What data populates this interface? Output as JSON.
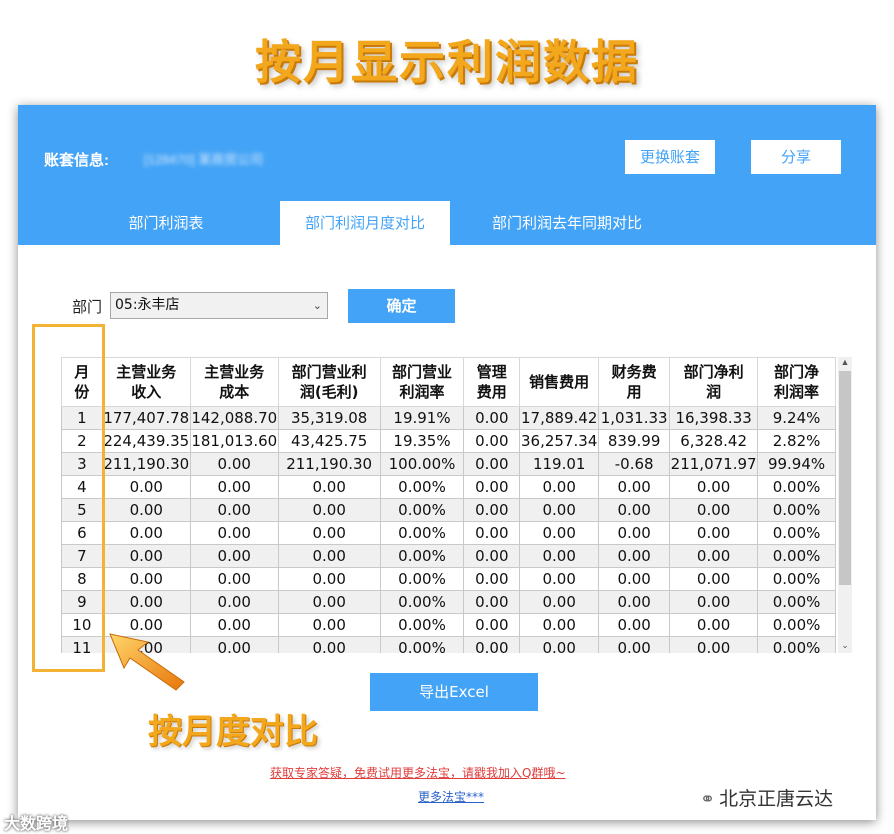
{
  "hero_title": "按月显示利润数据",
  "account": {
    "label": "账套信息:",
    "value": "[128470] 某商贸公司"
  },
  "buttons": {
    "switch_account": "更换账套",
    "share": "分享",
    "confirm": "确定",
    "export": "导出Excel"
  },
  "tabs": [
    {
      "label": "部门利润表",
      "active": false
    },
    {
      "label": "部门利润月度对比",
      "active": true
    },
    {
      "label": "部门利润去年同期对比",
      "active": false
    }
  ],
  "filter": {
    "label": "部门",
    "selected": "05:永丰店"
  },
  "table": {
    "columns": [
      "月份",
      "主营业务收入",
      "主营业务成本",
      "部门营业利润(毛利)",
      "部门营业利润率",
      "管理费用",
      "销售费用",
      "财务费用",
      "部门净利润",
      "部门净利润率"
    ],
    "header_lines": [
      [
        "月",
        "份"
      ],
      [
        "主营业务",
        "收入"
      ],
      [
        "主营业务",
        "成本"
      ],
      [
        "部门营业利",
        "润(毛利)"
      ],
      [
        "部门营业",
        "利润率"
      ],
      [
        "管理",
        "费用"
      ],
      [
        "销售费用",
        ""
      ],
      [
        "财务费",
        "用"
      ],
      [
        "部门净利",
        "润"
      ],
      [
        "部门净",
        "利润率"
      ]
    ],
    "rows": [
      [
        "1",
        "177,407.78",
        "142,088.70",
        "35,319.08",
        "19.91%",
        "0.00",
        "17,889.42",
        "1,031.33",
        "16,398.33",
        "9.24%"
      ],
      [
        "2",
        "224,439.35",
        "181,013.60",
        "43,425.75",
        "19.35%",
        "0.00",
        "36,257.34",
        "839.99",
        "6,328.42",
        "2.82%"
      ],
      [
        "3",
        "211,190.30",
        "0.00",
        "211,190.30",
        "100.00%",
        "0.00",
        "119.01",
        "-0.68",
        "211,071.97",
        "99.94%"
      ],
      [
        "4",
        "0.00",
        "0.00",
        "0.00",
        "0.00%",
        "0.00",
        "0.00",
        "0.00",
        "0.00",
        "0.00%"
      ],
      [
        "5",
        "0.00",
        "0.00",
        "0.00",
        "0.00%",
        "0.00",
        "0.00",
        "0.00",
        "0.00",
        "0.00%"
      ],
      [
        "6",
        "0.00",
        "0.00",
        "0.00",
        "0.00%",
        "0.00",
        "0.00",
        "0.00",
        "0.00",
        "0.00%"
      ],
      [
        "7",
        "0.00",
        "0.00",
        "0.00",
        "0.00%",
        "0.00",
        "0.00",
        "0.00",
        "0.00",
        "0.00%"
      ],
      [
        "8",
        "0.00",
        "0.00",
        "0.00",
        "0.00%",
        "0.00",
        "0.00",
        "0.00",
        "0.00",
        "0.00%"
      ],
      [
        "9",
        "0.00",
        "0.00",
        "0.00",
        "0.00%",
        "0.00",
        "0.00",
        "0.00",
        "0.00",
        "0.00%"
      ],
      [
        "10",
        "0.00",
        "0.00",
        "0.00",
        "0.00%",
        "0.00",
        "0.00",
        "0.00",
        "0.00",
        "0.00%"
      ],
      [
        "11",
        "0.00",
        "0.00",
        "0.00",
        "0.00%",
        "0.00",
        "0.00",
        "0.00",
        "0.00",
        "0.00%"
      ]
    ]
  },
  "annotation": {
    "caption": "按月度对比"
  },
  "links": {
    "expert": "获取专家答疑，免费试用更多法宝，请戳我加入Q群哦~",
    "more": "更多法宝***"
  },
  "watermarks": {
    "left": "大数跨境",
    "right": "北京正唐云达"
  },
  "colors": {
    "primary": "#43a3f6",
    "highlight": "#f2b233",
    "title": "#f2a71c",
    "link_red": "#e03c3c",
    "link_blue": "#2a62c9"
  }
}
